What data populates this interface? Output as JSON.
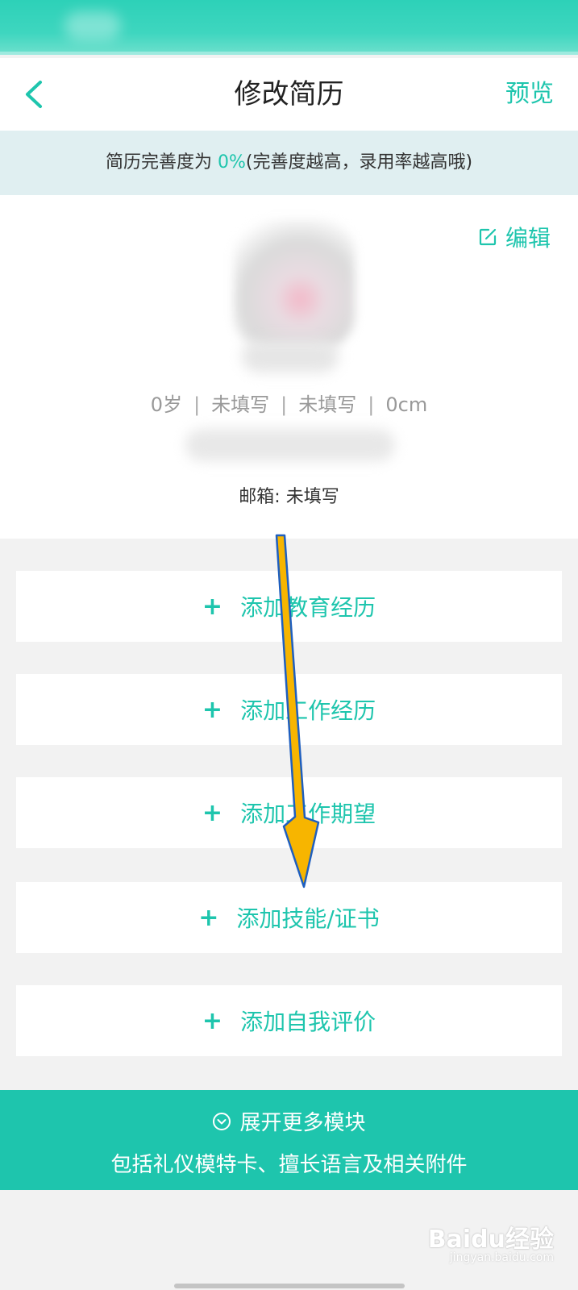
{
  "nav": {
    "title": "修改简历",
    "preview_label": "预览",
    "back_icon": "chevron-left-icon"
  },
  "tip": {
    "prefix": "简历完善度为 ",
    "percent": "0%",
    "suffix": "(完善度越高，录用率越高哦)"
  },
  "profile": {
    "edit_label": "编辑",
    "age": "0岁",
    "field2": "未填写",
    "field3": "未填写",
    "height": "0cm",
    "separator": "|",
    "email": "邮箱: 未填写"
  },
  "sections": [
    {
      "plus": "+",
      "label": "添加教育经历"
    },
    {
      "plus": "+",
      "label": "添加工作经历"
    },
    {
      "plus": "+",
      "label": "添加工作期望"
    },
    {
      "plus": "+",
      "label": "添加技能/证书"
    },
    {
      "plus": "+",
      "label": "添加自我评价"
    }
  ],
  "expand": {
    "title": "展开更多模块",
    "subtitle": "包括礼仪模特卡、擅长语言及相关附件"
  },
  "watermark": {
    "brand": "Baidu经验",
    "url": "jingyan.baidu.com"
  },
  "colors": {
    "accent": "#1ec5ad",
    "tip_bg": "#e0eff1",
    "arrow_fill": "#f7b500",
    "arrow_stroke": "#1f5fbf"
  }
}
